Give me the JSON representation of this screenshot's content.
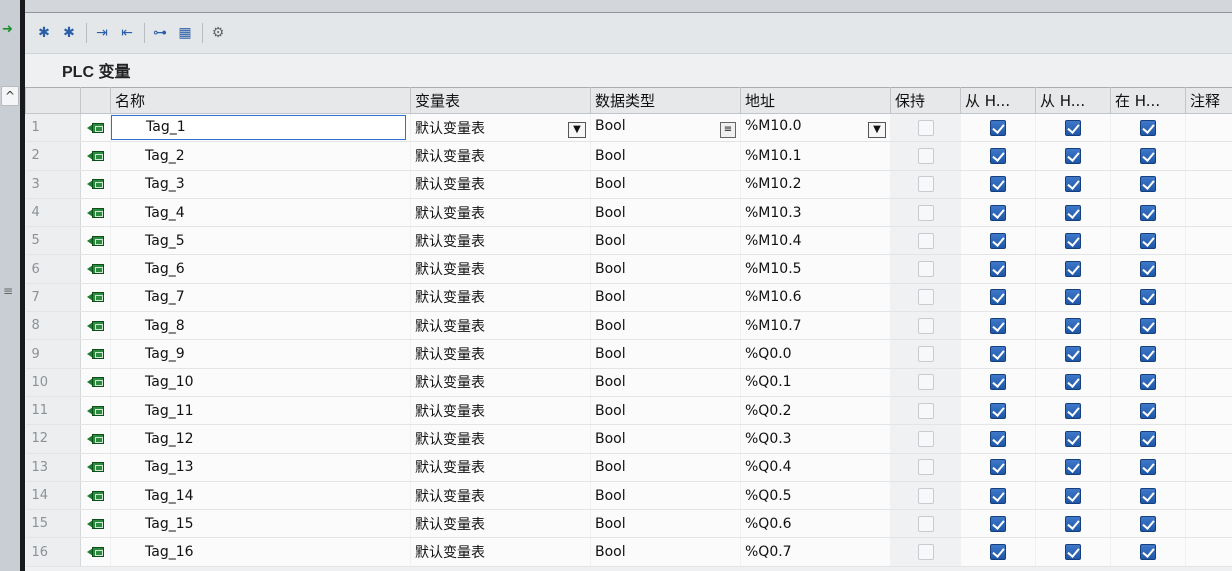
{
  "panel": {
    "title": "PLC 变量"
  },
  "columns": [
    "名称",
    "变量表",
    "数据类型",
    "地址",
    "保持",
    "从 H...",
    "从 H...",
    "在 H...",
    "注释"
  ],
  "toolbar": {
    "icons": [
      "add-new-tag-icon",
      "insert-row-icon",
      "export-icon",
      "import-icon",
      "monitor-icon",
      "show-references-icon",
      "settings-icon"
    ]
  },
  "rows": [
    {
      "num": "1",
      "name": "Tag_1",
      "table": "默认变量表",
      "type": "Bool",
      "address": "%M10.0",
      "retain": false,
      "hmi_access": true,
      "hmi_write": true,
      "hmi_visible": true,
      "comment": ""
    },
    {
      "num": "2",
      "name": "Tag_2",
      "table": "默认变量表",
      "type": "Bool",
      "address": "%M10.1",
      "retain": false,
      "hmi_access": true,
      "hmi_write": true,
      "hmi_visible": true,
      "comment": ""
    },
    {
      "num": "3",
      "name": "Tag_3",
      "table": "默认变量表",
      "type": "Bool",
      "address": "%M10.2",
      "retain": false,
      "hmi_access": true,
      "hmi_write": true,
      "hmi_visible": true,
      "comment": ""
    },
    {
      "num": "4",
      "name": "Tag_4",
      "table": "默认变量表",
      "type": "Bool",
      "address": "%M10.3",
      "retain": false,
      "hmi_access": true,
      "hmi_write": true,
      "hmi_visible": true,
      "comment": ""
    },
    {
      "num": "5",
      "name": "Tag_5",
      "table": "默认变量表",
      "type": "Bool",
      "address": "%M10.4",
      "retain": false,
      "hmi_access": true,
      "hmi_write": true,
      "hmi_visible": true,
      "comment": ""
    },
    {
      "num": "6",
      "name": "Tag_6",
      "table": "默认变量表",
      "type": "Bool",
      "address": "%M10.5",
      "retain": false,
      "hmi_access": true,
      "hmi_write": true,
      "hmi_visible": true,
      "comment": ""
    },
    {
      "num": "7",
      "name": "Tag_7",
      "table": "默认变量表",
      "type": "Bool",
      "address": "%M10.6",
      "retain": false,
      "hmi_access": true,
      "hmi_write": true,
      "hmi_visible": true,
      "comment": ""
    },
    {
      "num": "8",
      "name": "Tag_8",
      "table": "默认变量表",
      "type": "Bool",
      "address": "%M10.7",
      "retain": false,
      "hmi_access": true,
      "hmi_write": true,
      "hmi_visible": true,
      "comment": ""
    },
    {
      "num": "9",
      "name": "Tag_9",
      "table": "默认变量表",
      "type": "Bool",
      "address": "%Q0.0",
      "retain": false,
      "hmi_access": true,
      "hmi_write": true,
      "hmi_visible": true,
      "comment": ""
    },
    {
      "num": "10",
      "name": "Tag_10",
      "table": "默认变量表",
      "type": "Bool",
      "address": "%Q0.1",
      "retain": false,
      "hmi_access": true,
      "hmi_write": true,
      "hmi_visible": true,
      "comment": ""
    },
    {
      "num": "11",
      "name": "Tag_11",
      "table": "默认变量表",
      "type": "Bool",
      "address": "%Q0.2",
      "retain": false,
      "hmi_access": true,
      "hmi_write": true,
      "hmi_visible": true,
      "comment": ""
    },
    {
      "num": "12",
      "name": "Tag_12",
      "table": "默认变量表",
      "type": "Bool",
      "address": "%Q0.3",
      "retain": false,
      "hmi_access": true,
      "hmi_write": true,
      "hmi_visible": true,
      "comment": ""
    },
    {
      "num": "13",
      "name": "Tag_13",
      "table": "默认变量表",
      "type": "Bool",
      "address": "%Q0.4",
      "retain": false,
      "hmi_access": true,
      "hmi_write": true,
      "hmi_visible": true,
      "comment": ""
    },
    {
      "num": "14",
      "name": "Tag_14",
      "table": "默认变量表",
      "type": "Bool",
      "address": "%Q0.5",
      "retain": false,
      "hmi_access": true,
      "hmi_write": true,
      "hmi_visible": true,
      "comment": ""
    },
    {
      "num": "15",
      "name": "Tag_15",
      "table": "默认变量表",
      "type": "Bool",
      "address": "%Q0.6",
      "retain": false,
      "hmi_access": true,
      "hmi_write": true,
      "hmi_visible": true,
      "comment": ""
    },
    {
      "num": "16",
      "name": "Tag_16",
      "table": "默认变量表",
      "type": "Bool",
      "address": "%Q0.7",
      "retain": false,
      "hmi_access": true,
      "hmi_write": true,
      "hmi_visible": true,
      "comment": ""
    }
  ],
  "selected_row": 1,
  "colors": {
    "accent": "#2f6fce",
    "checkbox": "#1e57a8",
    "tag_icon": "#2a8a3d"
  }
}
